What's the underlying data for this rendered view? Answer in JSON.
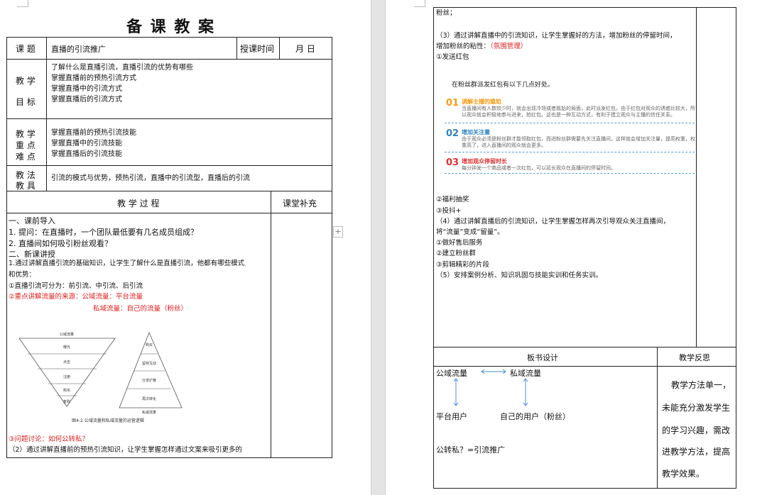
{
  "title": "备 课 教 案",
  "header_row": {
    "topic_label": "课  题",
    "topic_value": "直播的引流推广",
    "time_label": "授课时间",
    "time_value": "月  日"
  },
  "goals": {
    "label_1": "教 学",
    "label_2": "目 标",
    "lines": [
      "了解什么是直播引流，直播引流的优势有哪些",
      "掌握直播前的预热引流方式",
      "掌握直播中的引流方式",
      "掌握直播后的引流方式"
    ]
  },
  "keypoints": {
    "labels": [
      "教 学",
      "重 点",
      "难 点"
    ],
    "lines": [
      "掌握直播前的预热引流技能",
      "掌握直播中的引流技能",
      "掌握直播后的引流技能"
    ]
  },
  "methods": {
    "labels": [
      "教 法",
      "教 具"
    ],
    "text": "引流的模式与优势，预热引流，直播中的引流型，直播后的引流"
  },
  "process_header": "教 学 过 程",
  "supplement_header": "课堂补充",
  "process": {
    "l1": "一、课前导入",
    "l2": "1. 提问：在直播时，一个团队最低要有几名成员组成？",
    "l3": "2. 直播间如何吸引粉丝观看？",
    "l4": "二、新课讲授",
    "l5": "1.通过讲解直播引流的基础知识，让学生了解什么是直播引流，他都有哪些模式",
    "l6": "和优势：",
    "l7": "①直播引流可分为：前引流、中引流、后引流",
    "l8": "②重点讲解流量的来源：公域流量：平台流量",
    "l9": "私域流量：自己的流量（粉丝）",
    "l10": "③问题讨论：如何公转私？",
    "l11": "（2）通过讲解直播前的预热引流知识，让学生掌握怎样通过文案来吸引更多的"
  },
  "figure": {
    "left_title": "公域流量",
    "left_layers": [
      "曝光",
      "点击",
      "注册",
      "购买",
      "复购"
    ],
    "right_layers": [
      "购买",
      "留存互动",
      "分享扩散",
      "再次转化"
    ],
    "right_title": "私域流量",
    "caption": "图4-2  公域流量和私域流量的运营逻辑"
  },
  "right": {
    "r1": "粉丝；",
    "r2": "（3）通过讲解直播中的引流知识，让学生掌握好的方法，增加粉丝的停留时间，",
    "r3a": "增加粉丝的粘性：",
    "r3b": "（氛围管理）",
    "r4": "①发送红包",
    "redpack_title": "在粉丝群派发红包有以下几点好处。",
    "redpack_items": [
      {
        "num": "01",
        "head": "调解主播的尴尬",
        "text": "当直播间有人数较少时，就会出现冷场或者尴尬的局面，此时派发红包，由于红包对观众的诱惑比较大，所以观众就会积极地参与进来，抢红包。这也是一种互动方式，有利于建立观众与主播的信任关系。"
      },
      {
        "num": "02",
        "head": "增加关注量",
        "text": "由于观众必须是粉丝群才能领取红包，而进粉丝群需要先关注直播间，这样就会增加关注量，提高权重，权重高了，进入直播间的观众就会更多。"
      },
      {
        "num": "03",
        "head": "增加观众停留时长",
        "text": "每分钟发一个商品或者一次红包，可以延长观众在直播间的停留时间。"
      }
    ],
    "r5": "②福利抽奖",
    "r6": "③投抖+",
    "r7": "（4）通过讲解直播后的引流知识，让学生掌握怎样再次引导观众关注直播间，",
    "r8": "将“流量”变成“留量”。",
    "r9": "①做好售后服务",
    "r10": "②建立粉丝群",
    "r11": "③剪辑精彩的片段",
    "r12": "（5）安排案例分析、知识巩固与技能实训和任务实训。"
  },
  "board": {
    "header": "板书设计",
    "public": "公域流量",
    "private": "私域流量",
    "platform_users": "平台用户",
    "own_users": "自己的用户（粉丝）",
    "formula": "公转私？=引流推广"
  },
  "reflection": {
    "header": "教学反思",
    "lines": [
      "教学方法单一，",
      "未能充分激发学生",
      "的学习兴趣，需改",
      "进教学方法，提高",
      "教学效果。"
    ]
  },
  "colors": {
    "red": "#e02020",
    "num1": "#f39c12",
    "num2": "#2e86c1",
    "num3": "#e03030",
    "arrow": "#4a90d9"
  }
}
